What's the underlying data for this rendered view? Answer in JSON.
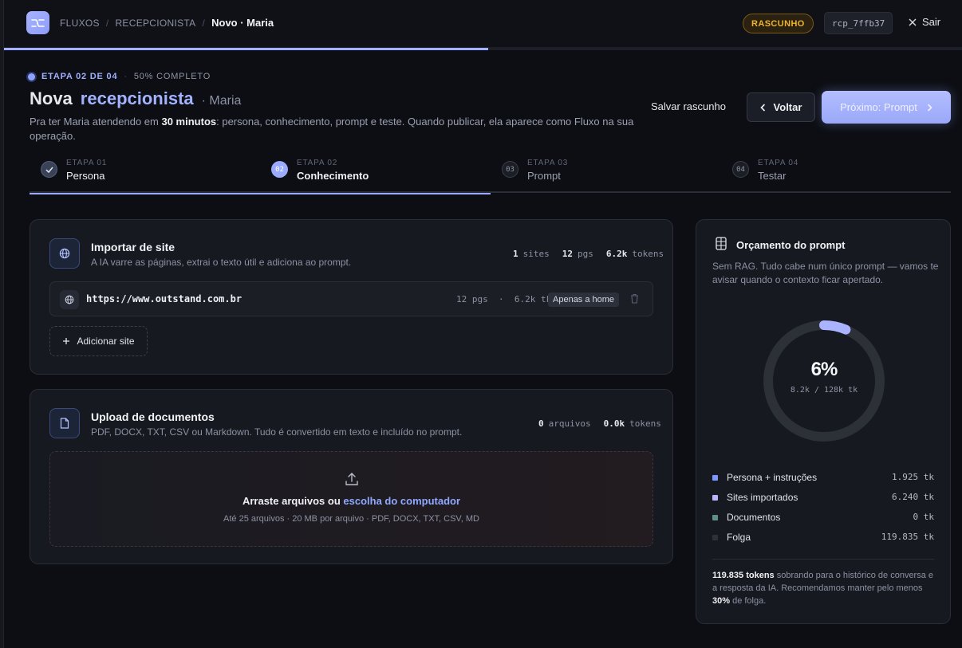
{
  "topbar": {
    "crumbs": [
      "FLUXOS",
      "RECEPCIONISTA",
      "Novo · Maria"
    ],
    "separator": "/",
    "status_badge": "RASCUNHO",
    "id_chip": "rcp_7ffb37",
    "exit_label": "Sair",
    "progress_fraction": 0.505
  },
  "header": {
    "step_label": "ETAPA 02 DE 04",
    "progress_label": "50% COMPLETO",
    "title_main": "Nova",
    "title_accent": "recepcionista",
    "title_sub": "· Maria",
    "desc_pre": "Pra ter Maria atendendo em ",
    "desc_bold": "30 minutos",
    "desc_post": ": persona, conhecimento, prompt e teste. Quando publicar, ela aparece como Fluxo na sua operação.",
    "save_draft": "Salvar rascunho",
    "back": "Voltar",
    "next": "Próximo: Prompt"
  },
  "steps": [
    {
      "small": "ETAPA 01",
      "label": "Persona",
      "num": "✓",
      "state": "done"
    },
    {
      "small": "ETAPA 02",
      "label": "Conhecimento",
      "num": "02",
      "state": "active"
    },
    {
      "small": "ETAPA 03",
      "label": "Prompt",
      "num": "03",
      "state": "pending"
    },
    {
      "small": "ETAPA 04",
      "label": "Testar",
      "num": "04",
      "state": "pending"
    }
  ],
  "import_site": {
    "title": "Importar de site",
    "subtitle": "A IA varre as páginas, extrai o texto útil e adiciona ao prompt.",
    "stats": {
      "sites_n": "1",
      "sites_l": "sites",
      "pgs_n": "12",
      "pgs_l": "pgs",
      "tokens_n": "6.2k",
      "tokens_l": "tokens"
    },
    "row": {
      "url": "https://www.outstand.com.br",
      "meta": "12 pgs  ·  6.2k tk",
      "chip": "Apenas a home"
    },
    "add": "Adicionar site"
  },
  "upload": {
    "title": "Upload de documentos",
    "subtitle": "PDF, DOCX, TXT, CSV ou Markdown. Tudo é convertido em texto e incluído no prompt.",
    "stats": {
      "files_n": "0",
      "files_l": "arquivos",
      "tokens_n": "0.0k",
      "tokens_l": "tokens"
    },
    "drop_pre": "Arraste arquivos ou ",
    "drop_link": "escolha do computador",
    "drop_sub": "Até 25 arquivos · 20 MB por arquivo · PDF, DOCX, TXT, CSV, MD"
  },
  "budget": {
    "title": "Orçamento do prompt",
    "desc": "Sem RAG. Tudo cabe num único prompt — vamos te avisar quando o contexto ficar apertado.",
    "pct": "6%",
    "usage": "8.2k / 128k tk",
    "fraction_used": 0.064,
    "legend": [
      {
        "name": "Persona + instruções",
        "value": "1.925 tk",
        "color": "#7f95ff"
      },
      {
        "name": "Sites importados",
        "value": "6.240 tk",
        "color": "#b8b5ff"
      },
      {
        "name": "Documentos",
        "value": "0 tk",
        "color": "#5f8f86"
      },
      {
        "name": "Folga",
        "value": "119.835 tk",
        "color": "#2d3139"
      }
    ],
    "note_bold1": "119.835 tokens",
    "note_mid": " sobrando para o histórico de conversa e a resposta da IA. Recomendamos manter pelo menos ",
    "note_bold2": "30%",
    "note_end": " de folga."
  }
}
